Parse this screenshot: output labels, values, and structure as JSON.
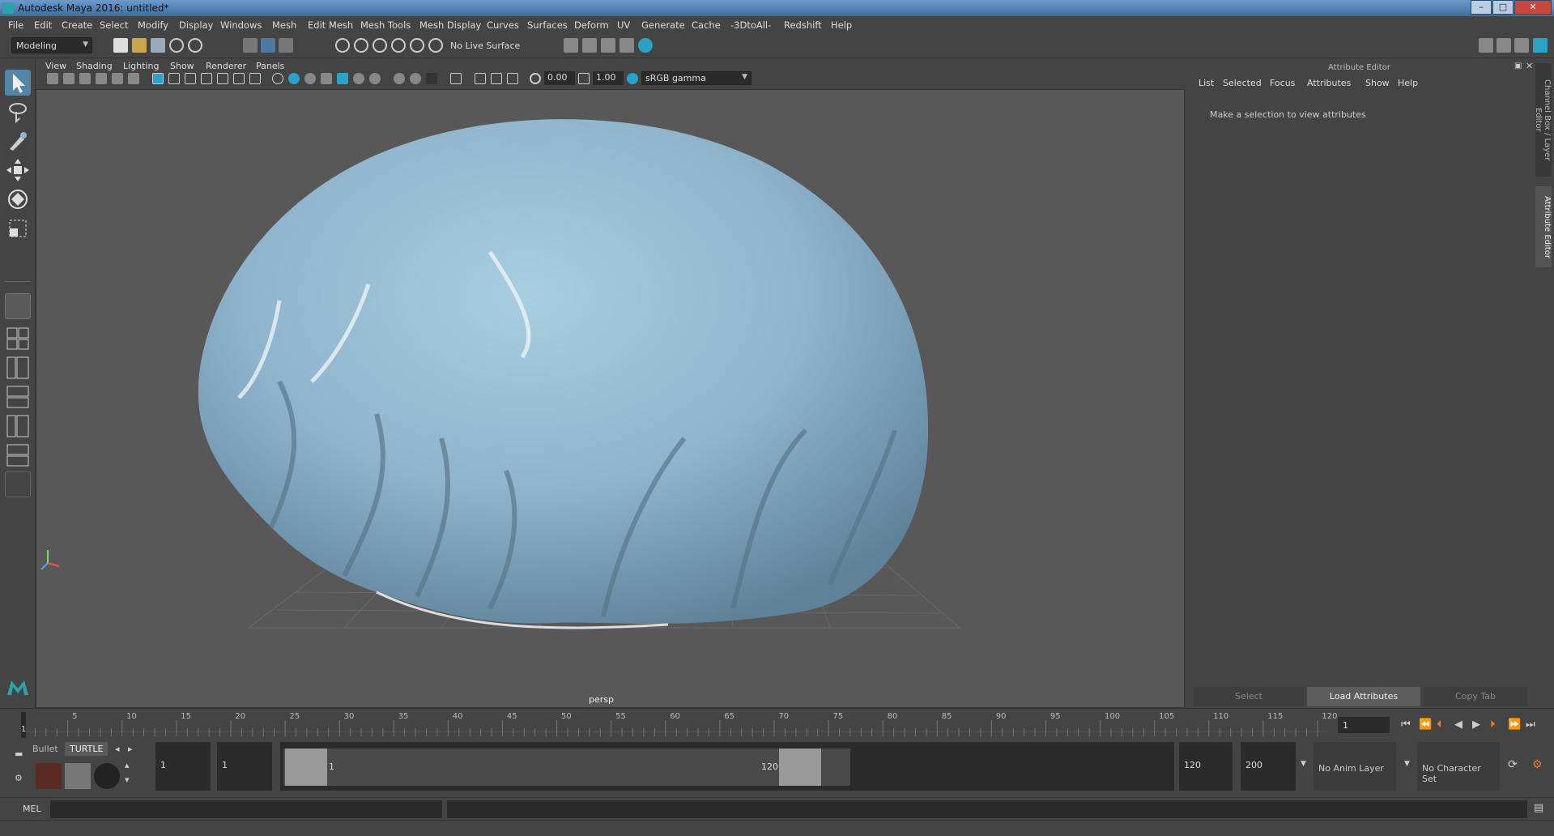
{
  "window": {
    "title": "Autodesk Maya 2016: untitled*",
    "buttons": [
      "–",
      "□",
      "✕"
    ]
  },
  "menubar": [
    "File",
    "Edit",
    "Create",
    "Select",
    "Modify",
    "Display",
    "Windows",
    "Mesh",
    "Edit Mesh",
    "Mesh Tools",
    "Mesh Display",
    "Curves",
    "Surfaces",
    "Deform",
    "UV",
    "Generate",
    "Cache",
    "-3DtoAll-",
    "Redshift",
    "Help"
  ],
  "toolbar": {
    "mode": "Modeling",
    "live_surface": "No Live Surface"
  },
  "viewport": {
    "menus": [
      "View",
      "Shading",
      "Lighting",
      "Show",
      "Renderer",
      "Panels"
    ],
    "exposure": "0.00",
    "gamma": "1.00",
    "color_space": "sRGB gamma",
    "camera_label": "persp",
    "accent": "#2aa3c9",
    "mesh_color": "#8fb4cc"
  },
  "attribute_editor": {
    "title": "Attribute Editor",
    "menus": [
      "List",
      "Selected",
      "Focus",
      "Attributes",
      "Show",
      "Help"
    ],
    "message": "Make a selection to view attributes",
    "buttons": {
      "select": "Select",
      "load": "Load Attributes",
      "copy": "Copy Tab"
    }
  },
  "side_tabs": {
    "channel_box": "Channel Box / Layer Editor",
    "attribute_editor": "Attribute Editor"
  },
  "timeline": {
    "ticks": [
      "5",
      "10",
      "15",
      "20",
      "25",
      "30",
      "35",
      "40",
      "45",
      "50",
      "55",
      "60",
      "65",
      "70",
      "75",
      "80",
      "85",
      "90",
      "95",
      "100",
      "105",
      "110",
      "115",
      "120"
    ],
    "start_label": "1",
    "current_frame": "1"
  },
  "shelf_tabs": {
    "bullet": "Bullet",
    "turtle": "TURTLE"
  },
  "range": {
    "start": "1",
    "start_inner": "1",
    "slider_start": "1",
    "slider_end": "120",
    "end": "120",
    "end_outer": "200",
    "anim_layer": "No Anim Layer",
    "character_set": "No Character Set"
  },
  "command": {
    "label": "MEL"
  }
}
